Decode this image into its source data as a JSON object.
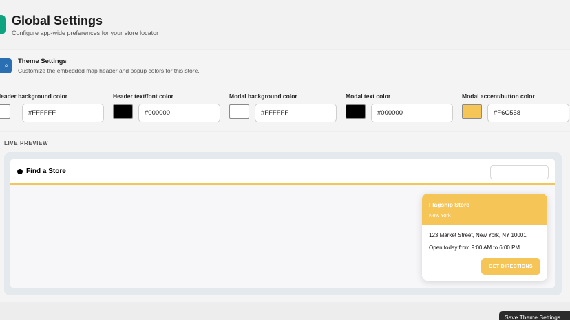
{
  "header": {
    "title": "Global Settings",
    "subtitle": "Configure app-wide preferences for your store locator"
  },
  "theme": {
    "title": "Theme Settings",
    "description": "Customize the embedded map header and popup colors for this store.",
    "icon": "search-icon",
    "fields": [
      {
        "label": "Header background color",
        "value": "#FFFFFF",
        "swatch": "#FFFFFF"
      },
      {
        "label": "Header text/font color",
        "value": "#000000",
        "swatch": "#000000"
      },
      {
        "label": "Modal background color",
        "value": "#FFFFFF",
        "swatch": "#FFFFFF"
      },
      {
        "label": "Modal text color",
        "value": "#000000",
        "swatch": "#000000"
      },
      {
        "label": "Modal accent/button color",
        "value": "#F6C558",
        "swatch": "#F6C558"
      }
    ]
  },
  "preview": {
    "label": "LIVE PREVIEW",
    "map_title": "Find a Store",
    "popup": {
      "name": "Flagship Store",
      "city": "New York",
      "address": "123 Market Street, New York, NY 10001",
      "hours": "Open today from 9:00 AM to 6:00 PM",
      "button": "GET DIRECTIONS"
    }
  },
  "footer": {
    "save_label": "Save Theme Settings"
  },
  "colors": {
    "accent": "#F6C558",
    "brand": "#10A37F"
  }
}
